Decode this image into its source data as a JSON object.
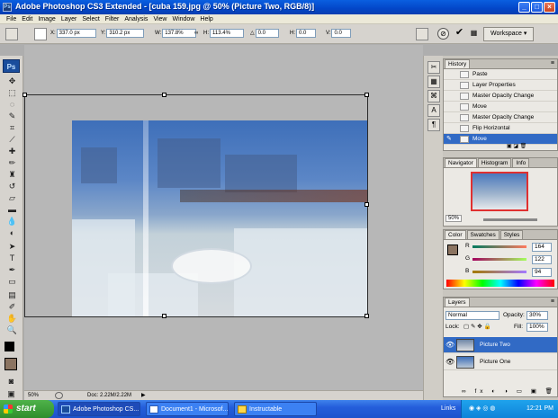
{
  "window": {
    "title": "Adobe Photoshop CS3 Extended - [cuba 159.jpg @ 50% (Picture Two, RGB/8)]",
    "app_badge": "Ps"
  },
  "menu": [
    "File",
    "Edit",
    "Image",
    "Layer",
    "Select",
    "Filter",
    "Analysis",
    "View",
    "Window",
    "Help"
  ],
  "options": {
    "x_label": "X:",
    "x_value": "337.0 px",
    "y_label": "Y:",
    "y_value": "310.2 px",
    "w_label": "W:",
    "w_value": "137.8%",
    "h_label": "H:",
    "h_value": "113.4%",
    "angle_value": "0.0",
    "hskew_label": "H:",
    "hskew_value": "0.0",
    "vskew_label": "V:",
    "vskew_value": "0.0",
    "cancel_icon": "cancel-icon",
    "commit_icon": "check-icon",
    "workspace_label": "Workspace ▾"
  },
  "tools": {
    "logo": "Ps",
    "foreground_color": "#000000",
    "background_color": "#8b7461"
  },
  "document": {
    "zoom": "50%",
    "doc_size": "Doc: 2.22M/2.22M"
  },
  "history": {
    "tabs": [
      "History"
    ],
    "rows": [
      {
        "label": "Paste",
        "selected": false
      },
      {
        "label": "Layer Properties",
        "selected": false
      },
      {
        "label": "Master Opacity Change",
        "selected": false
      },
      {
        "label": "Move",
        "selected": false
      },
      {
        "label": "Master Opacity Change",
        "selected": false
      },
      {
        "label": "Flip Horizontal",
        "selected": false
      },
      {
        "label": "Move",
        "selected": true
      }
    ]
  },
  "navigator": {
    "tabs": [
      "Navigator",
      "Histogram",
      "Info"
    ],
    "zoom": "50%"
  },
  "color": {
    "tabs": [
      "Color",
      "Swatches",
      "Styles"
    ],
    "r_label": "R",
    "r_value": "164",
    "g_label": "G",
    "g_value": "122",
    "b_label": "B",
    "b_value": "94",
    "swatch_color": "#8b7461"
  },
  "layers": {
    "tabs": [
      "Layers"
    ],
    "blend_mode": "Normal",
    "opacity_label": "Opacity:",
    "opacity_value": "30%",
    "lock_label": "Lock:",
    "fill_label": "Fill:",
    "fill_value": "100%",
    "items": [
      {
        "name": "Picture Two",
        "selected": true
      },
      {
        "name": "Picture One",
        "selected": false
      }
    ]
  },
  "taskbar": {
    "start_label": "start",
    "tasks": [
      {
        "label": "Adobe Photoshop CS...",
        "active": true
      },
      {
        "label": "Document1 - Microsof...",
        "active": false
      },
      {
        "label": "Instructable",
        "active": false
      }
    ],
    "links_label": "Links",
    "clock": "12:21 PM"
  }
}
